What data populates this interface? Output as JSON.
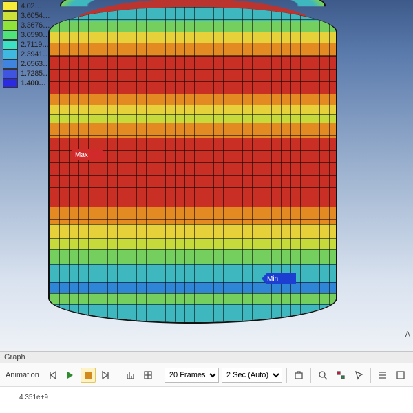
{
  "legend": {
    "items": [
      {
        "color": "#f8ec3a",
        "label": "4.02…"
      },
      {
        "color": "#cce23a",
        "label": "3.6054…"
      },
      {
        "color": "#8fe33a",
        "label": "3.3676…"
      },
      {
        "color": "#4fe37a",
        "label": "3.0590…"
      },
      {
        "color": "#3ee0c3",
        "label": "2.7119…"
      },
      {
        "color": "#3fb9e0",
        "label": "2.3941…"
      },
      {
        "color": "#3f85e0",
        "label": "2.0563…"
      },
      {
        "color": "#3f55e0",
        "label": "1.7285…"
      },
      {
        "color": "#2a2ae0",
        "label": "1.400…"
      }
    ]
  },
  "markers": {
    "max": "Max",
    "min": "Min"
  },
  "corner_axis": "A",
  "panels": {
    "graph": "Graph"
  },
  "toolbar": {
    "animation_label": "Animation",
    "frames_options": [
      "20 Frames"
    ],
    "frames_selected": "20 Frames",
    "time_options": [
      "2 Sec (Auto)"
    ],
    "time_selected": "2 Sec (Auto)"
  },
  "graph": {
    "ytick": "4.351e+9"
  },
  "icons": {
    "step_back": "step-back-icon",
    "play": "play-icon",
    "stop": "stop-icon",
    "step_fwd": "step-fwd-icon",
    "chart1": "chart-icon",
    "chart2": "chart-grid-icon",
    "export": "export-icon",
    "zoom": "zoom-icon",
    "probe": "probe-icon",
    "cursor": "cursor-icon",
    "list": "list-icon",
    "fit": "fit-icon"
  }
}
